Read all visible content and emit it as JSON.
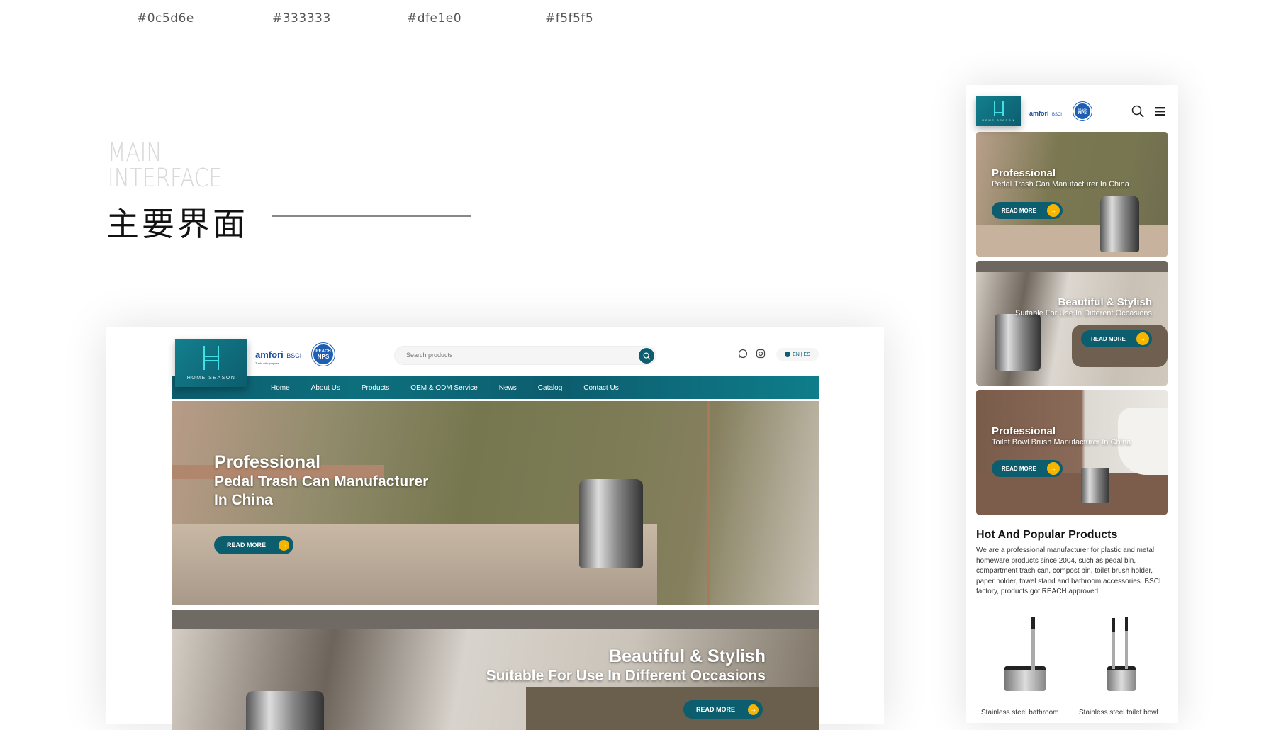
{
  "palette": {
    "colors": [
      "#0c5d6e",
      "#333333",
      "#dfe1e0",
      "#f5f5f5"
    ]
  },
  "section": {
    "title_en_line1": "MAIN",
    "title_en_line2": "INTERFACE",
    "title_cn": "主要界面"
  },
  "desktop": {
    "logo_text": "HOME SEASON",
    "badges": {
      "amfori": "amfori",
      "amfori_tagline": "Trade with purpose",
      "bsci": "BSCI",
      "reach_top": "REACH",
      "reach_bottom": "NPS"
    },
    "search": {
      "placeholder": "Search products",
      "icon": "search-icon"
    },
    "social": [
      "whatsapp-icon",
      "instagram-icon"
    ],
    "language": "EN | ES",
    "nav": [
      "Home",
      "About Us",
      "Products",
      "OEM & ODM Service",
      "News",
      "Catalog",
      "Contact Us"
    ],
    "hero1": {
      "title": "Professional",
      "line1": "Pedal Trash Can Manufacturer",
      "line2": "In China",
      "button": "READ MORE"
    },
    "hero2": {
      "title": "Beautiful & Stylish",
      "subtitle": "Suitable For Use In Different Occasions",
      "button": "READ MORE"
    }
  },
  "mobile": {
    "logo_text": "HOME SEASON",
    "icons": [
      "search-icon",
      "menu-icon"
    ],
    "cards": [
      {
        "title": "Professional",
        "subtitle": "Pedal Trash Can Manufacturer In China",
        "button": "READ MORE"
      },
      {
        "title": "Beautiful & Stylish",
        "subtitle": "Suitable For Use In Different Occasions",
        "button": "READ MORE"
      },
      {
        "title": "Professional",
        "subtitle": "Toilet Bowl Brush Manufacturer In China",
        "button": "READ MORE"
      }
    ],
    "products_heading": "Hot And Popular Products",
    "products_text": "We are a professional manufacturer for plastic and metal homeware products since 2004, such as pedal bin, compartment trash can, compost bin, toilet brush holder, paper holder, towel stand and bathroom accessories. BSCI factory, products got REACH approved.",
    "products": [
      {
        "caption": "Stainless steel bathroom"
      },
      {
        "caption": "Stainless steel toilet bowl"
      }
    ]
  }
}
